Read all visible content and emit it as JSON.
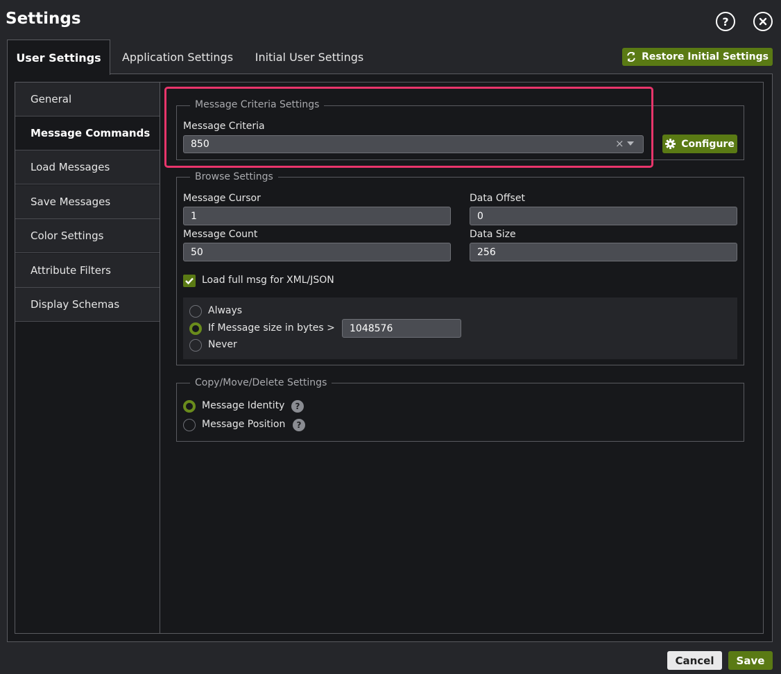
{
  "window": {
    "title": "Settings",
    "help_icon": "question-circle-icon",
    "close_icon": "close-circle-icon"
  },
  "tabs": [
    {
      "label": "User Settings",
      "active": true
    },
    {
      "label": "Application Settings",
      "active": false
    },
    {
      "label": "Initial User Settings",
      "active": false
    }
  ],
  "restore_button": {
    "label": "Restore Initial Settings",
    "icon": "refresh-icon"
  },
  "sidebar": {
    "items": [
      {
        "label": "General"
      },
      {
        "label": "Message Commands",
        "active": true
      },
      {
        "label": "Load Messages"
      },
      {
        "label": "Save Messages"
      },
      {
        "label": "Color Settings"
      },
      {
        "label": "Attribute Filters"
      },
      {
        "label": "Display Schemas"
      }
    ]
  },
  "criteria": {
    "legend": "Message Criteria Settings",
    "label": "Message Criteria",
    "value": "850",
    "clear_glyph": "×",
    "configure_label": "Configure",
    "configure_icon": "gear-icon"
  },
  "browse": {
    "legend": "Browse Settings",
    "cursor_label": "Message Cursor",
    "cursor_value": "1",
    "offset_label": "Data Offset",
    "offset_value": "0",
    "count_label": "Message Count",
    "count_value": "50",
    "size_label": "Data Size",
    "size_value": "256",
    "load_full_label": "Load full msg for XML/JSON",
    "load_full_checked": true,
    "radio_always": "Always",
    "radio_if_size": "If Message size in bytes >",
    "radio_never": "Never",
    "selected_radio": "If Message size in bytes >",
    "size_threshold": "1048576"
  },
  "copymove": {
    "legend": "Copy/Move/Delete Settings",
    "identity_label": "Message Identity",
    "position_label": "Message Position",
    "selected": "Message Identity",
    "help_glyph": "?"
  },
  "footer": {
    "cancel_label": "Cancel",
    "save_label": "Save"
  },
  "colors": {
    "accent_green": "#5a7a14",
    "highlight_pink": "#e8356b",
    "background": "#25262a",
    "panel": "#17181b"
  }
}
